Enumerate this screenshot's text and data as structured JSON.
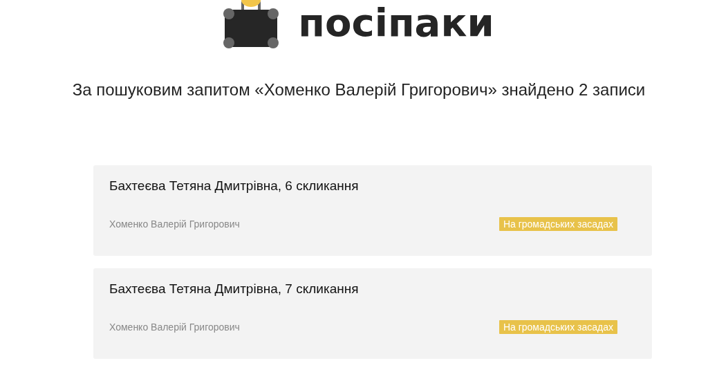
{
  "logo": {
    "text": "посіпаки"
  },
  "heading": "За пошуковим запитом «Хоменко Валерій Григорович» знайдено 2 записи",
  "results": [
    {
      "title": "Бахтеєва Тетяна Дмитрівна, 6 скликання",
      "person": "Хоменко Валерій Григорович",
      "tag": "На громадських засадах"
    },
    {
      "title": "Бахтеєва Тетяна Дмитрівна, 7 скликання",
      "person": "Хоменко Валерій Григорович",
      "tag": "На громадських засадах"
    }
  ]
}
